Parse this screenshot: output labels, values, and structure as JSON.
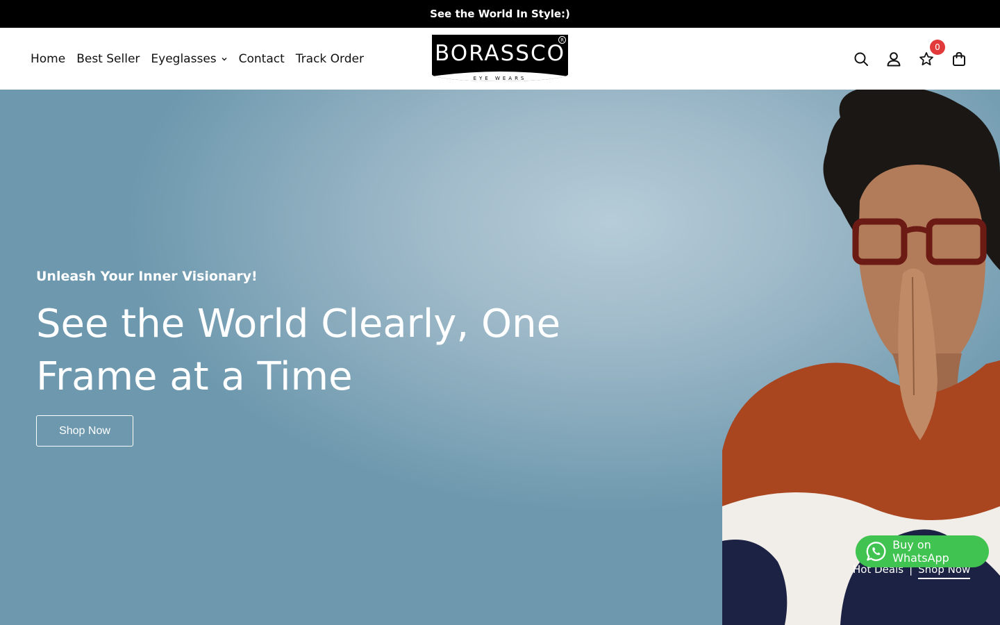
{
  "announcement": "See the World In Style:)",
  "nav": {
    "items": [
      {
        "label": "Home"
      },
      {
        "label": "Best Seller"
      },
      {
        "label": "Eyeglasses"
      },
      {
        "label": "Contact"
      },
      {
        "label": "Track Order"
      }
    ]
  },
  "logo": {
    "brand": "BORASSCO",
    "tagline": "EYE WEARS",
    "reg": "R"
  },
  "header_icons": {
    "wishlist_count": "0"
  },
  "hero": {
    "subtitle": "Unleash Your Inner Visionary!",
    "title": "See the World Clearly, One Frame at a Time",
    "cta": "Shop Now",
    "hot_deals": "Hot Deals",
    "separator": "|",
    "hot_shop": "Shop Now"
  },
  "whatsapp": {
    "label": "Buy on WhatsApp"
  },
  "colors": {
    "announcement_bg": "#000000",
    "badge": "#e23a3a",
    "whatsapp": "#40c351"
  }
}
